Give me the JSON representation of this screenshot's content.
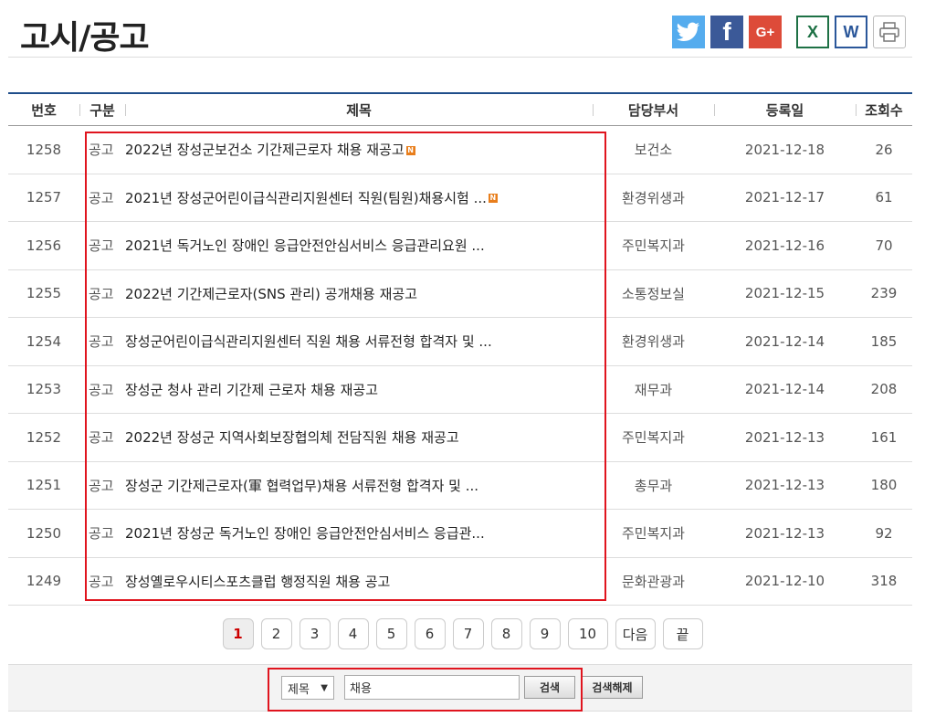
{
  "page_title": "고시/공고",
  "share_icons": [
    {
      "name": "twitter-icon",
      "glyph": "🐦"
    },
    {
      "name": "facebook-icon",
      "glyph": "f"
    },
    {
      "name": "googleplus-icon",
      "glyph": "G+"
    },
    {
      "name": "excel-icon",
      "glyph": "X"
    },
    {
      "name": "word-icon",
      "glyph": "W"
    },
    {
      "name": "print-icon",
      "glyph": "🖶"
    }
  ],
  "columns": {
    "num": "번호",
    "cat": "구분",
    "subject": "제목",
    "dept": "담당부서",
    "date": "등록일",
    "views": "조회수"
  },
  "rows": [
    {
      "num": "1258",
      "cat": "공고",
      "subject": "2022년 장성군보건소 기간제근로자 채용 재공고",
      "new": true,
      "dept": "보건소",
      "date": "2021-12-18",
      "views": "26"
    },
    {
      "num": "1257",
      "cat": "공고",
      "subject": "2021년 장성군어린이급식관리지원센터 직원(팀원)채용시험 ...",
      "new": true,
      "dept": "환경위생과",
      "date": "2021-12-17",
      "views": "61"
    },
    {
      "num": "1256",
      "cat": "공고",
      "subject": "2021년 독거노인 장애인 응급안전안심서비스 응급관리요원 ...",
      "new": false,
      "dept": "주민복지과",
      "date": "2021-12-16",
      "views": "70"
    },
    {
      "num": "1255",
      "cat": "공고",
      "subject": "2022년 기간제근로자(SNS 관리) 공개채용 재공고",
      "new": false,
      "dept": "소통정보실",
      "date": "2021-12-15",
      "views": "239"
    },
    {
      "num": "1254",
      "cat": "공고",
      "subject": "장성군어린이급식관리지원센터 직원 채용 서류전형 합격자 및 ...",
      "new": false,
      "dept": "환경위생과",
      "date": "2021-12-14",
      "views": "185"
    },
    {
      "num": "1253",
      "cat": "공고",
      "subject": "장성군 청사 관리 기간제 근로자 채용 재공고",
      "new": false,
      "dept": "재무과",
      "date": "2021-12-14",
      "views": "208"
    },
    {
      "num": "1252",
      "cat": "공고",
      "subject": "2022년 장성군 지역사회보장협의체 전담직원 채용 재공고",
      "new": false,
      "dept": "주민복지과",
      "date": "2021-12-13",
      "views": "161"
    },
    {
      "num": "1251",
      "cat": "공고",
      "subject": "장성군 기간제근로자(軍 협력업무)채용 서류전형 합격자 및 ...",
      "new": false,
      "dept": "총무과",
      "date": "2021-12-13",
      "views": "180"
    },
    {
      "num": "1250",
      "cat": "공고",
      "subject": "2021년 장성군 독거노인 장애인 응급안전안심서비스 응급관...",
      "new": false,
      "dept": "주민복지과",
      "date": "2021-12-13",
      "views": "92"
    },
    {
      "num": "1249",
      "cat": "공고",
      "subject": "장성옐로우시티스포츠클럽 행정직원 채용 공고",
      "new": false,
      "dept": "문화관광과",
      "date": "2021-12-10",
      "views": "318"
    }
  ],
  "new_badge": "N",
  "pagination": {
    "pages": [
      "1",
      "2",
      "3",
      "4",
      "5",
      "6",
      "7",
      "8",
      "9",
      "10"
    ],
    "current": "1",
    "next": "다음",
    "last": "끝"
  },
  "search": {
    "field": "제목",
    "query": "채용",
    "search_label": "검색",
    "reset_label": "검색해제"
  },
  "colors": {
    "highlight": "#e0141e",
    "header_border": "#1f4e8a",
    "current_page": "#cc0000"
  }
}
